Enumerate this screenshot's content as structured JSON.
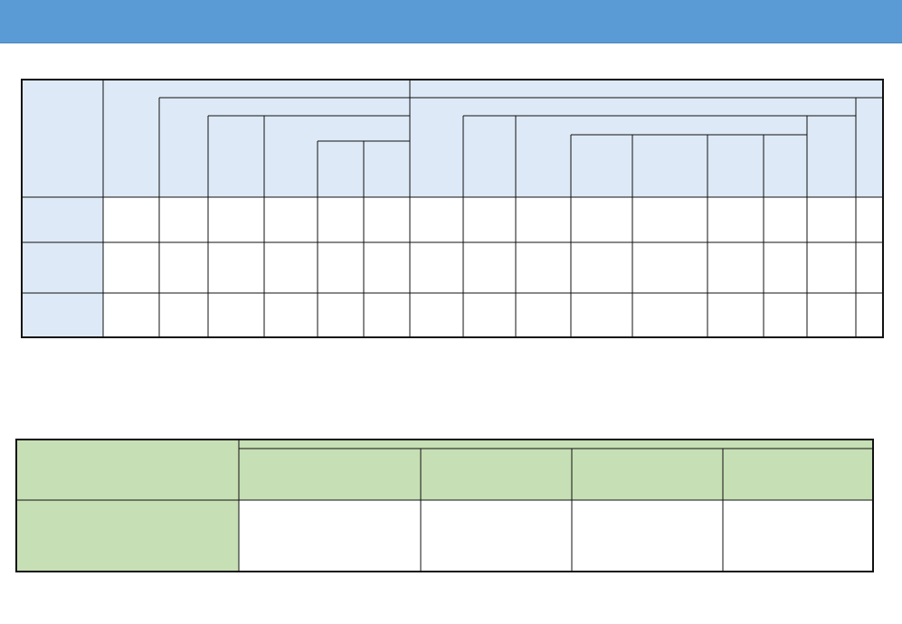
{
  "header_bar": {
    "color": "#5b9bd5"
  },
  "table_1": {
    "header_fill": "#dde9f6",
    "rows": [
      "",
      "",
      ""
    ]
  },
  "table_2": {
    "header_fill": "#c6dfb5",
    "rows": [
      ""
    ]
  }
}
